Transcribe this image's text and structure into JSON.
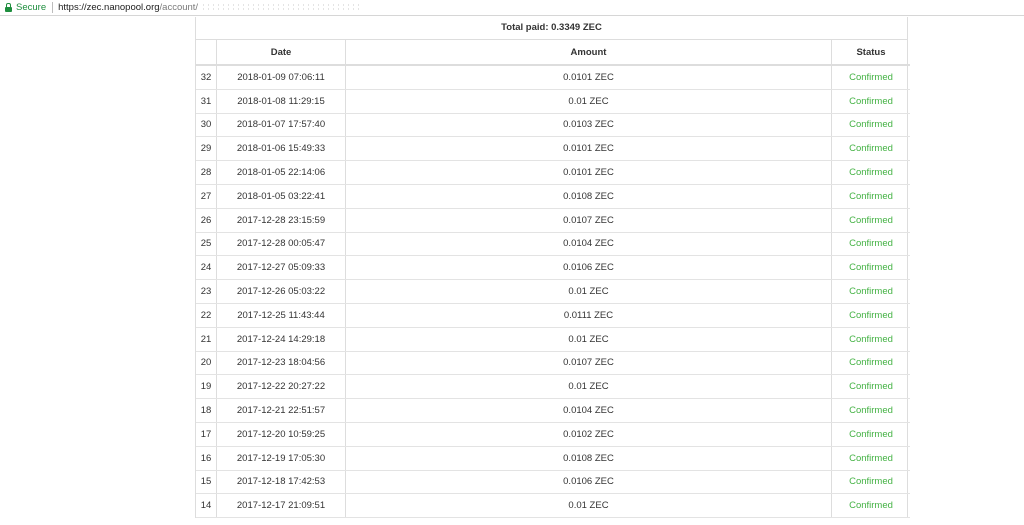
{
  "browser": {
    "secure_label": "Secure",
    "url_host": "https://zec.nanopool.org",
    "url_path": "/account/"
  },
  "payments": {
    "total_paid": "Total paid: 0.3349 ZEC",
    "columns": [
      "",
      "Date",
      "Amount",
      "Status"
    ],
    "status_color": "#44b244",
    "rows": [
      {
        "num": "32",
        "date": "2018-01-09 07:06:11",
        "amount": "0.0101 ZEC",
        "status": "Confirmed"
      },
      {
        "num": "31",
        "date": "2018-01-08 11:29:15",
        "amount": "0.01 ZEC",
        "status": "Confirmed"
      },
      {
        "num": "30",
        "date": "2018-01-07 17:57:40",
        "amount": "0.0103 ZEC",
        "status": "Confirmed"
      },
      {
        "num": "29",
        "date": "2018-01-06 15:49:33",
        "amount": "0.0101 ZEC",
        "status": "Confirmed"
      },
      {
        "num": "28",
        "date": "2018-01-05 22:14:06",
        "amount": "0.0101 ZEC",
        "status": "Confirmed"
      },
      {
        "num": "27",
        "date": "2018-01-05 03:22:41",
        "amount": "0.0108 ZEC",
        "status": "Confirmed"
      },
      {
        "num": "26",
        "date": "2017-12-28 23:15:59",
        "amount": "0.0107 ZEC",
        "status": "Confirmed"
      },
      {
        "num": "25",
        "date": "2017-12-28 00:05:47",
        "amount": "0.0104 ZEC",
        "status": "Confirmed"
      },
      {
        "num": "24",
        "date": "2017-12-27 05:09:33",
        "amount": "0.0106 ZEC",
        "status": "Confirmed"
      },
      {
        "num": "23",
        "date": "2017-12-26 05:03:22",
        "amount": "0.01 ZEC",
        "status": "Confirmed"
      },
      {
        "num": "22",
        "date": "2017-12-25 11:43:44",
        "amount": "0.0111 ZEC",
        "status": "Confirmed"
      },
      {
        "num": "21",
        "date": "2017-12-24 14:29:18",
        "amount": "0.01 ZEC",
        "status": "Confirmed"
      },
      {
        "num": "20",
        "date": "2017-12-23 18:04:56",
        "amount": "0.0107 ZEC",
        "status": "Confirmed"
      },
      {
        "num": "19",
        "date": "2017-12-22 20:27:22",
        "amount": "0.01 ZEC",
        "status": "Confirmed"
      },
      {
        "num": "18",
        "date": "2017-12-21 22:51:57",
        "amount": "0.0104 ZEC",
        "status": "Confirmed"
      },
      {
        "num": "17",
        "date": "2017-12-20 10:59:25",
        "amount": "0.0102 ZEC",
        "status": "Confirmed"
      },
      {
        "num": "16",
        "date": "2017-12-19 17:05:30",
        "amount": "0.0108 ZEC",
        "status": "Confirmed"
      },
      {
        "num": "15",
        "date": "2017-12-18 17:42:53",
        "amount": "0.0106 ZEC",
        "status": "Confirmed"
      },
      {
        "num": "14",
        "date": "2017-12-17 21:09:51",
        "amount": "0.01 ZEC",
        "status": "Confirmed"
      }
    ]
  }
}
